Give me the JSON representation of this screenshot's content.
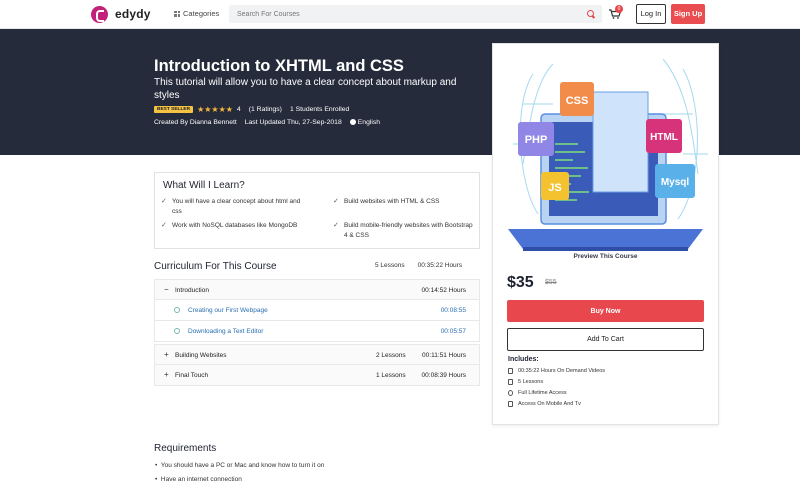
{
  "header": {
    "brand": "edydy",
    "categories_label": "Categories",
    "search_placeholder": "Search For Courses",
    "cart_count": "0",
    "login_label": "Log In",
    "signup_label": "Sign Up"
  },
  "hero": {
    "title": "Introduction to XHTML and CSS",
    "subtitle": "This tutorial will allow you to have a clear concept about markup and styles",
    "badge": "BEST SELLER",
    "stars": "★★★★★",
    "rating": "4",
    "ratings_count": "(1 Ratings)",
    "enrolled": "1 Students Enrolled",
    "created_by": "Created By Dianna Bennett",
    "last_updated": "Last Updated Thu, 27-Sep-2018",
    "language": "English"
  },
  "learn": {
    "title": "What Will I Learn?",
    "items": [
      "You will have a clear concept about html and css",
      "Build websites with HTML & CSS",
      "Work with NoSQL databases like MongoDB",
      "Build mobile-friendly websites with Bootstrap 4 & CSS"
    ]
  },
  "curriculum": {
    "title": "Curriculum For This Course",
    "total_lessons": "5 Lessons",
    "total_time": "00:35:22 Hours",
    "rows": [
      {
        "sign": "−",
        "name": "Introduction",
        "lessons": "",
        "time": "00:14:52 Hours"
      },
      {
        "name": "Creating our First Webpage",
        "time": "00:08:55"
      },
      {
        "name": "Downloading a Text Editor",
        "time": "00:05:57"
      },
      {
        "sign": "+",
        "name": "Building Websites",
        "lessons": "2 Lessons",
        "time": "00:11:51 Hours"
      },
      {
        "sign": "+",
        "name": "Final Touch",
        "lessons": "1 Lessons",
        "time": "00:08:39 Hours"
      }
    ]
  },
  "requirements": {
    "title": "Requirements",
    "items": [
      "You should have a PC or Mac and know how to turn it on",
      "Have an internet connection"
    ]
  },
  "sidebar": {
    "preview_label": "Preview This Course",
    "preview_tags": [
      "CSS",
      "PHP",
      "HTML",
      "JS",
      "Mysql"
    ],
    "price": "$35",
    "old_price": "$55",
    "buy_label": "Buy Now",
    "cart_label": "Add To Cart",
    "includes_title": "Includes:",
    "includes": [
      "00:35:22 Hours On Demand Videos",
      "5 Lessons",
      "Full Lifetime Access",
      "Access On Mobile And Tv"
    ]
  },
  "colors": {
    "accent": "#ea4d4f",
    "hero_bg": "#252b3a",
    "brand": "#c2207a"
  }
}
